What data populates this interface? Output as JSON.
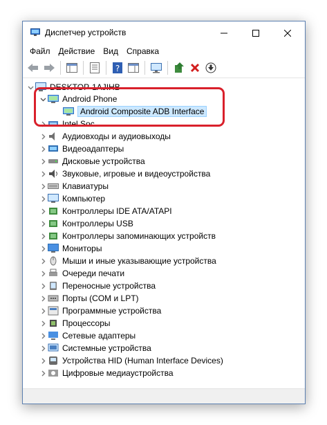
{
  "window": {
    "title": "Диспетчер устройств"
  },
  "menu": [
    "Файл",
    "Действие",
    "Вид",
    "Справка"
  ],
  "tree": {
    "root": "DESKTOP-1AJIHB",
    "expanded_category": "Android Phone",
    "selected_device": "Android Composite ADB Interface",
    "categories": [
      "Intel Soc",
      "Аудиовходы и аудиовыходы",
      "Видеоадаптеры",
      "Дисковые устройства",
      "Звуковые, игровые и видеоустройства",
      "Клавиатуры",
      "Компьютер",
      "Контроллеры IDE ATA/ATAPI",
      "Контроллеры USB",
      "Контроллеры запоминающих устройств",
      "Мониторы",
      "Мыши и иные указывающие устройства",
      "Очереди печати",
      "Переносные устройства",
      "Порты (COM и LPT)",
      "Программные устройства",
      "Процессоры",
      "Сетевые адаптеры",
      "Системные устройства",
      "Устройства HID (Human Interface Devices)",
      "Цифровые медиаустройства"
    ]
  },
  "colors": {
    "highlight": "#d9202b",
    "selection": "#cce8ff"
  }
}
